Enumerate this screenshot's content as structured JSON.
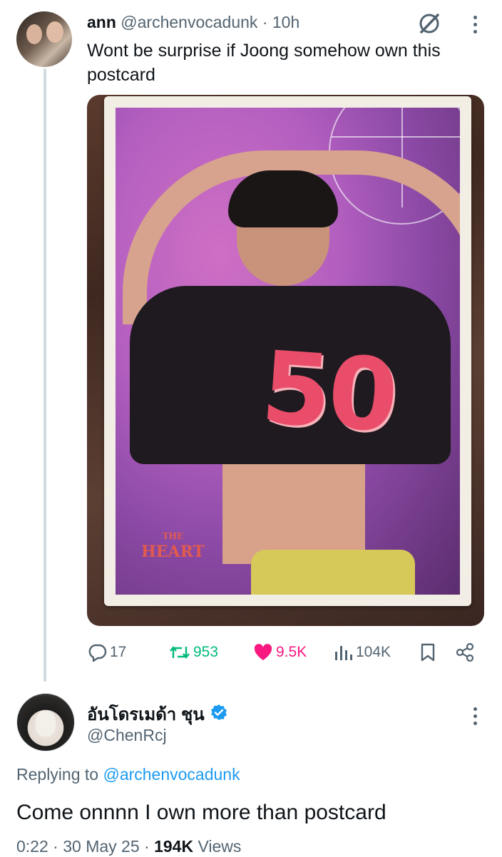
{
  "tweet1": {
    "display_name": "ann",
    "handle": "@archenvocadunk",
    "separator": "·",
    "time": "10h",
    "text": "Wont be surprise if Joong somehow own this postcard",
    "media": {
      "jersey_number": "50",
      "logo_title": "THE HEART",
      "logo_top": "THE",
      "logo_bottom": "HEART"
    },
    "actions": {
      "replies": "17",
      "reposts": "953",
      "likes": "9.5K",
      "views": "104K"
    }
  },
  "tweet2": {
    "display_name": "อันโดรเมด้า ชุน",
    "handle": "@ChenRcj",
    "replying_prefix": "Replying to",
    "replying_to": "@archenvocadunk",
    "text": "Come onnnn I own more than postcard",
    "time": "0:22",
    "date": "30 May 25",
    "views_count": "194K",
    "views_label": "Views",
    "separator": "·"
  },
  "icons": {
    "grok": "grok-icon",
    "more": "more-icon",
    "reply": "reply-icon",
    "repost": "repost-icon",
    "like": "heart-icon",
    "views": "views-icon",
    "bookmark": "bookmark-icon",
    "share": "share-icon",
    "verified": "verified-icon"
  },
  "colors": {
    "text": "#0f1419",
    "muted": "#536471",
    "link": "#1d9bf0",
    "repost": "#00ba7c",
    "like": "#f91880",
    "thread_line": "#cfd9de"
  }
}
